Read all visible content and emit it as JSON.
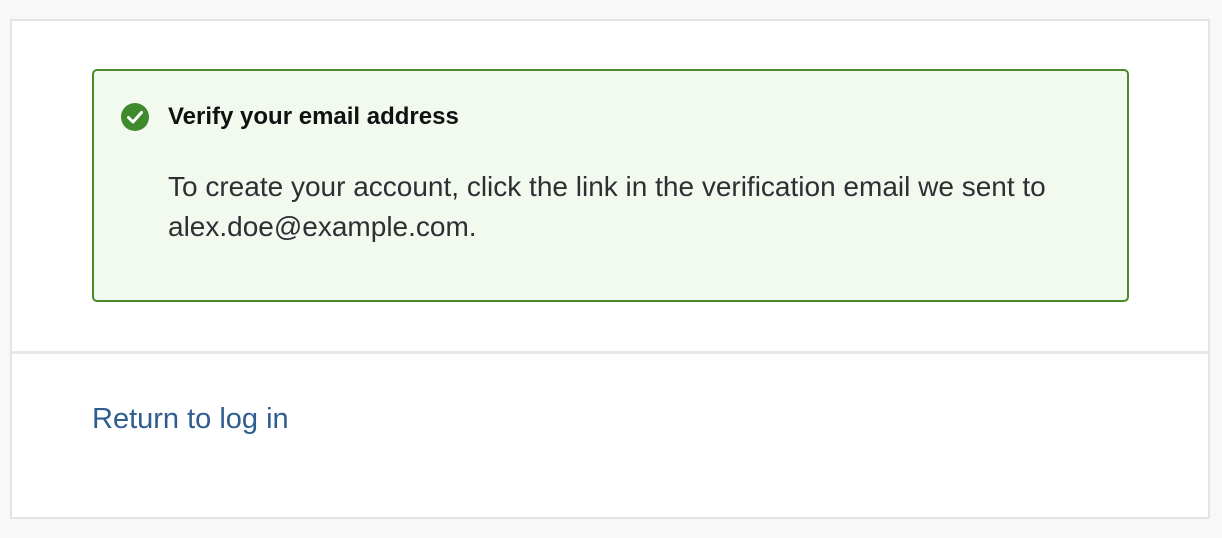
{
  "alert": {
    "icon": "check-circle-icon",
    "title": "Verify your email address",
    "message_prefix": "To create your account, click the link in the verification email we sent to ",
    "email": "alex.doe@example.com",
    "message_suffix": ".",
    "border_color": "#4a8a2a",
    "background_color": "#f2f9ef",
    "icon_color": "#3e8a2c"
  },
  "footer": {
    "return_link_label": "Return to log in",
    "link_color": "#2f5d8f"
  }
}
